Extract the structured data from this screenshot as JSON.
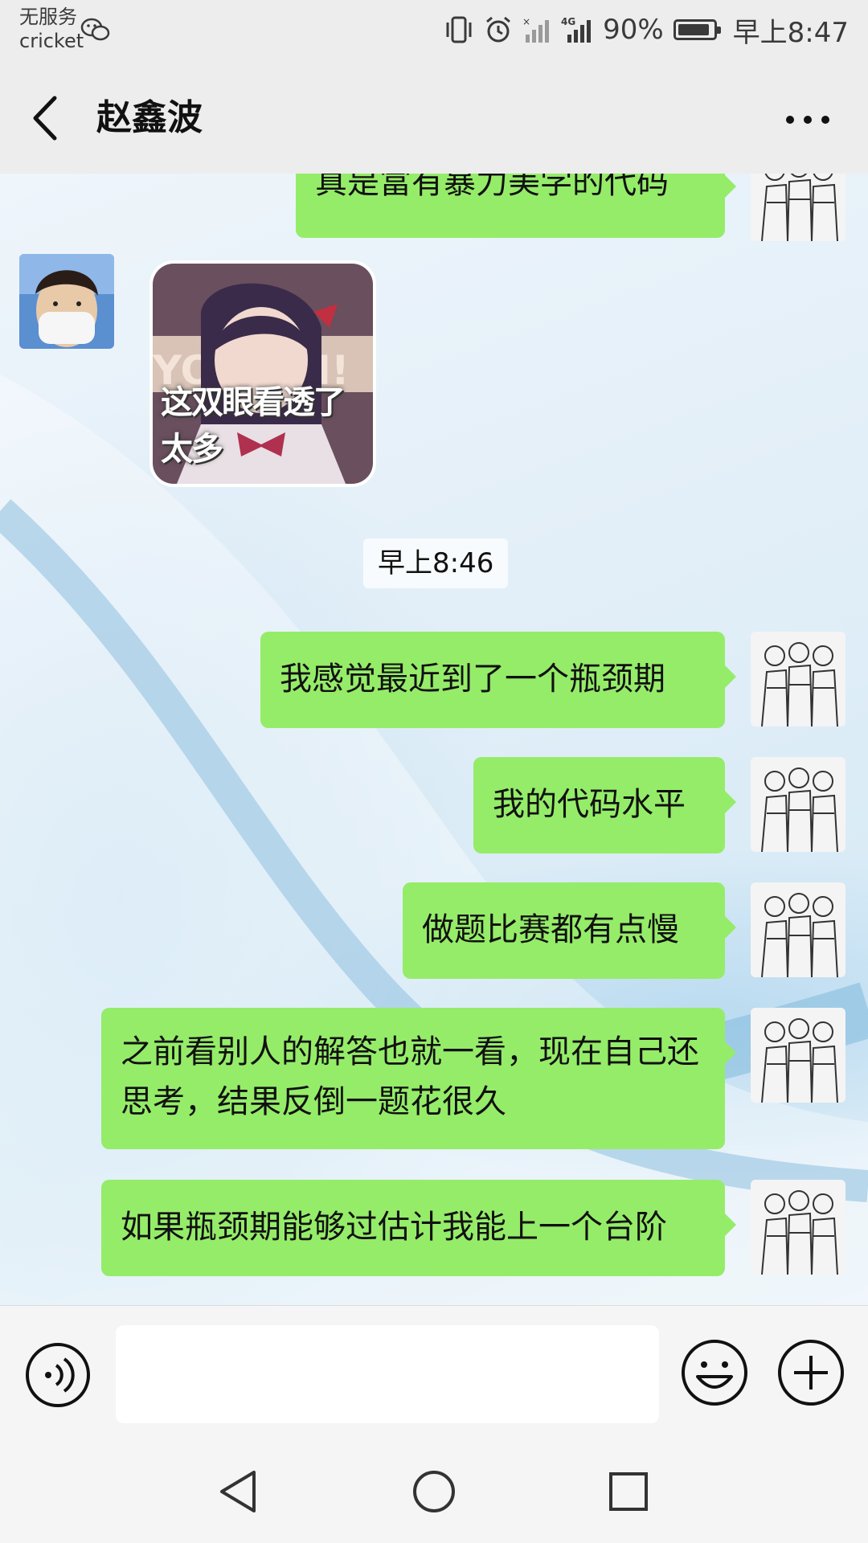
{
  "status_bar": {
    "carrier_line1": "无服务",
    "carrier_line2": "cricket",
    "battery": "90%",
    "time": "早上8:47",
    "battery_level": 0.9,
    "icons": [
      "wechat-icon",
      "vibrate-icon",
      "alarm-icon",
      "signal-off-icon",
      "4g-signal-icon",
      "battery-icon"
    ]
  },
  "header": {
    "title": "赵鑫波",
    "back_icon": "chevron-left-icon",
    "more_icon": "more-icon"
  },
  "chat": {
    "partial_message": "真是富有暴力美学的代码",
    "sticker_caption": "这双眼看透了太多",
    "timestamp": "早上8:46",
    "messages": [
      "我感觉最近到了一个瓶颈期",
      "我的代码水平",
      "做题比赛都有点慢",
      "之前看别人的解答也就一看，现在自己还思考，结果反倒一题花很久",
      "如果瓶颈期能够过估计我能上一个台阶"
    ],
    "bubble_color": "#95ec69"
  },
  "input_bar": {
    "voice_icon": "voice-icon",
    "emoji_icon": "emoji-icon",
    "plus_icon": "plus-icon",
    "input_value": ""
  },
  "nav_bar": {
    "icons": [
      "nav-back-icon",
      "nav-home-icon",
      "nav-recent-icon"
    ]
  }
}
